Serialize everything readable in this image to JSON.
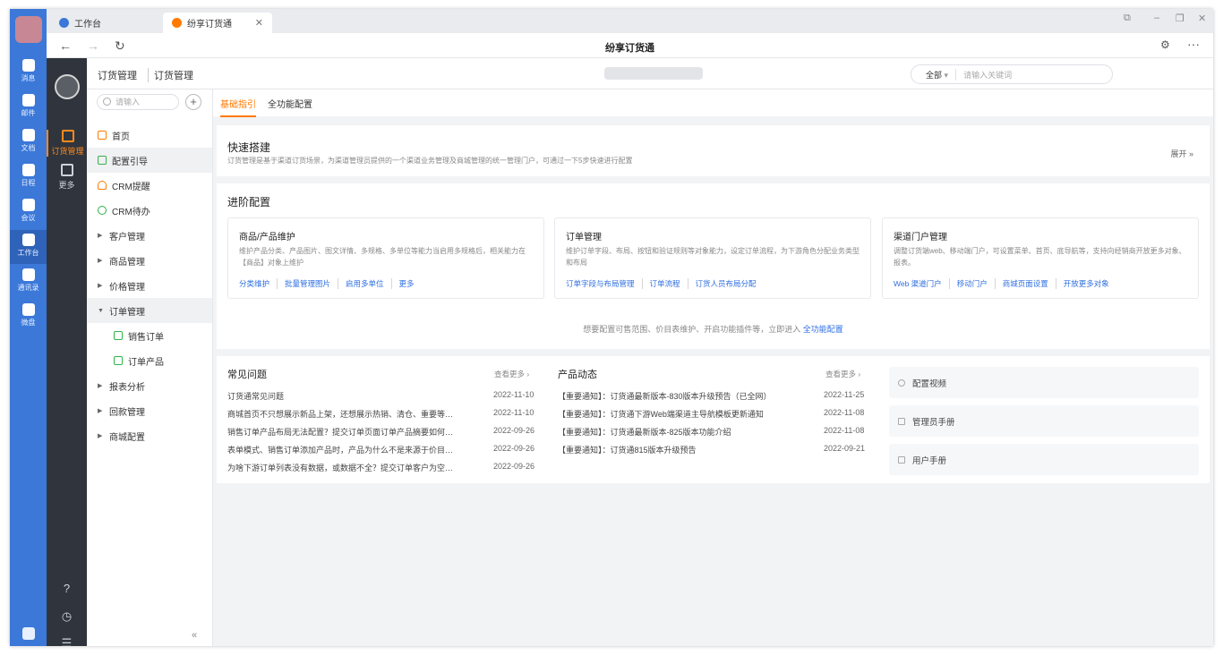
{
  "tabs": [
    {
      "label": "工作台"
    },
    {
      "label": "纷享订货通"
    }
  ],
  "nav": {
    "title": "纷享订货通"
  },
  "rail": {
    "items": [
      {
        "label": "消息"
      },
      {
        "label": "邮件"
      },
      {
        "label": "文档"
      },
      {
        "label": "日程"
      },
      {
        "label": "会议"
      },
      {
        "label": "工作台"
      },
      {
        "label": "通讯录"
      },
      {
        "label": "微盘"
      }
    ]
  },
  "appbar": {
    "items": [
      {
        "label": "订货管理"
      },
      {
        "label": "更多"
      }
    ]
  },
  "header": {
    "crumb1": "订货管理",
    "crumb2": "订货管理",
    "search_scope": "全部",
    "search_placeholder": "请输入关键词"
  },
  "menu": {
    "search_placeholder": "请输入",
    "items": [
      {
        "label": "首页"
      },
      {
        "label": "配置引导"
      },
      {
        "label": "CRM提醒"
      },
      {
        "label": "CRM待办"
      },
      {
        "label": "客户管理"
      },
      {
        "label": "商品管理"
      },
      {
        "label": "价格管理"
      },
      {
        "label": "订单管理"
      },
      {
        "label": "销售订单"
      },
      {
        "label": "订单产品"
      },
      {
        "label": "报表分析"
      },
      {
        "label": "回款管理"
      },
      {
        "label": "商城配置"
      }
    ]
  },
  "subtabs": [
    {
      "label": "基础指引"
    },
    {
      "label": "全功能配置"
    }
  ],
  "quick": {
    "title": "快速搭建",
    "desc": "订货管理是基于渠道订货场景，为渠道管理员提供的一个渠道业务管理及商城管理的统一管理门户，可通过一下5步快速进行配置",
    "expand": "展开"
  },
  "advanced": {
    "title": "进阶配置",
    "boxes": [
      {
        "title": "商品/产品维护",
        "desc": "维护产品分类、产品图片、图文详情、多规格、多单位等能力当启用多规格后，相关能力在【商品】对象上维护",
        "links": [
          "分类维护",
          "批量管理图片",
          "启用多单位",
          "更多"
        ]
      },
      {
        "title": "订单管理",
        "desc": "维护订单字段、布局、按钮和验证规则等对象能力，设定订单流程，为下游角色分配业务类型和布局",
        "links": [
          "订单字段与布局管理",
          "订单流程",
          "订货人员布局分配"
        ]
      },
      {
        "title": "渠道门户管理",
        "desc": "调整订货端web、移动端门户，可设置菜单、首页、底导航等，支持向经销商开放更多对象、报表。",
        "links": [
          "Web 渠道门户",
          "移动门户",
          "商城页面设置",
          "开放更多对象"
        ]
      }
    ],
    "note": "想要配置可售范围、价目表维护、开启功能插件等，立即进入",
    "note_link": "全功能配置"
  },
  "faq": {
    "title": "常见问题",
    "more": "查看更多",
    "items": [
      {
        "text": "订货通常见问题",
        "date": "2022-11-10"
      },
      {
        "text": "商城首页不只想展示新品上架，还想展示热销、清仓、重要等…",
        "date": "2022-11-10"
      },
      {
        "text": "销售订单产品布局无法配置？提交订单页面订单产品摘要如何…",
        "date": "2022-09-26"
      },
      {
        "text": "表单模式、销售订单添加产品时，产品为什么不是来源于价目…",
        "date": "2022-09-26"
      },
      {
        "text": "为啥下游订单列表没有数据，或数据不全？提交订单客户为空…",
        "date": "2022-09-26"
      }
    ]
  },
  "news": {
    "title": "产品动态",
    "more": "查看更多",
    "items": [
      {
        "text": "【重要通知】：订货通最新版本-830版本升级预告（已全网）",
        "date": "2022-11-25"
      },
      {
        "text": "【重要通知】：订货通下游Web端渠道主导航模板更新通知",
        "date": "2022-11-08"
      },
      {
        "text": "【重要通知】：订货通最新版本-825版本功能介绍",
        "date": "2022-11-08"
      },
      {
        "text": "【重要通知】：订货通815版本升级预告",
        "date": "2022-09-21"
      }
    ]
  },
  "side": [
    {
      "label": "配置视频"
    },
    {
      "label": "管理员手册"
    },
    {
      "label": "用户手册"
    }
  ],
  "colors": {
    "accent": "#ff7a00",
    "rail": "#3b78d8",
    "link": "#2f6fe0"
  }
}
